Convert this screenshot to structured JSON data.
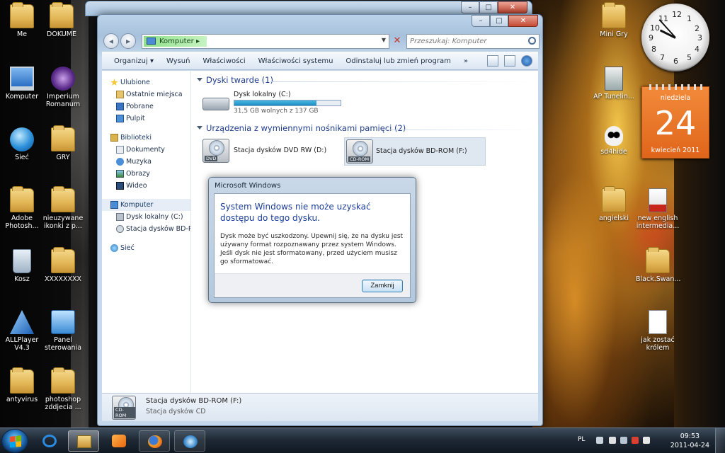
{
  "desktop": {
    "icons_left": [
      {
        "label": "Me",
        "icon": "folder-icon"
      },
      {
        "label": "DOKUME",
        "icon": "folder-icon"
      },
      {
        "label": "Komputer",
        "icon": "computer-icon"
      },
      {
        "label": "Imperium Romanum",
        "icon": "game-icon"
      },
      {
        "label": "Sieć",
        "icon": "network-icon"
      },
      {
        "label": "GRY",
        "icon": "folder-icon"
      },
      {
        "label": "Adobe Photosh...",
        "icon": "folder-icon"
      },
      {
        "label": "nieuzywane ikonki z p...",
        "icon": "folder-icon"
      },
      {
        "label": "Kosz",
        "icon": "recycle-bin-icon"
      },
      {
        "label": "XXXXXXXX",
        "icon": "folder-icon"
      },
      {
        "label": "ALLPlayer V4.3",
        "icon": "allplayer-icon"
      },
      {
        "label": "Panel sterowania",
        "icon": "control-panel-icon"
      },
      {
        "label": "antyvirus",
        "icon": "folder-icon"
      },
      {
        "label": "photoshop zddjecia ...",
        "icon": "folder-icon"
      }
    ],
    "icons_right": [
      {
        "label": "Mini Gry",
        "icon": "folder-icon"
      },
      {
        "label": "AP Tunelin...",
        "icon": "app-icon"
      },
      {
        "label": "sd4hide",
        "icon": "skull-icon"
      },
      {
        "label": "angielski",
        "icon": "folder-icon"
      },
      {
        "label": "new english intermedia...",
        "icon": "pdf-icon"
      },
      {
        "label": "Black.Swan...",
        "icon": "folder-icon"
      },
      {
        "label": "jak zostać królem",
        "icon": "file-icon"
      }
    ]
  },
  "explorer": {
    "address": {
      "crumb": "Komputer",
      "arrow": "▸"
    },
    "search_placeholder": "Przeszukaj: Komputer",
    "toolbar": {
      "organize": "Organizuj ▾",
      "eject": "Wysuń",
      "properties": "Właściwości",
      "system_properties": "Właściwości systemu",
      "uninstall": "Odinstaluj lub zmień program",
      "more": "»"
    },
    "nav": {
      "favorites": "Ulubione",
      "recent": "Ostatnie miejsca",
      "downloads": "Pobrane",
      "desktop": "Pulpit",
      "libraries": "Biblioteki",
      "documents": "Dokumenty",
      "music": "Muzyka",
      "pictures": "Obrazy",
      "video": "Wideo",
      "computer": "Komputer",
      "local_disk": "Dysk lokalny (C:)",
      "bd_drive": "Stacja dysków BD-RO",
      "network": "Sieć"
    },
    "hard_disks": {
      "header": "Dyski twarde (1)",
      "name": "Dysk lokalny (C:)",
      "free": "31,5 GB wolnych z 137 GB",
      "used_fraction": 0.77
    },
    "removable": {
      "header": "Urządzenia z wymiennymi nośnikami pamięci (2)",
      "dvd": "Stacja dysków DVD RW (D:)",
      "dvd_label": "DVD",
      "bd": "Stacja dysków BD-ROM (F:)",
      "bd_label": "CD-ROM"
    },
    "details": {
      "name": "Stacja dysków BD-ROM (F:)",
      "type": "Stacja dysków CD",
      "label": "CD-ROM"
    }
  },
  "dialog": {
    "title": "Microsoft Windows",
    "heading": "System Windows nie może uzyskać dostępu do tego dysku.",
    "text": "Dysk może być uszkodzony. Upewnij się, że na dysku jest używany format rozpoznawany przez system Windows. Jeśli dysk nie jest sformatowany, przed użyciem musisz go sformatować.",
    "button": "Zamknij"
  },
  "gadgets": {
    "clock_numbers": [
      "12",
      "1",
      "2",
      "3",
      "4",
      "5",
      "6",
      "7",
      "8",
      "9",
      "10",
      "11"
    ],
    "clock_time": {
      "hour": 9,
      "minute": 53
    },
    "calendar": {
      "day_name": "niedziela",
      "day": "24",
      "month_year": "kwiecień 2011"
    }
  },
  "taskbar": {
    "lang": "PL",
    "time": "09:53",
    "date": "2011-04-24"
  },
  "colors": {
    "accent_blue": "#1e3d8c",
    "calendar_orange": "#e0651b",
    "usage_fill": "#1d8dc3"
  }
}
